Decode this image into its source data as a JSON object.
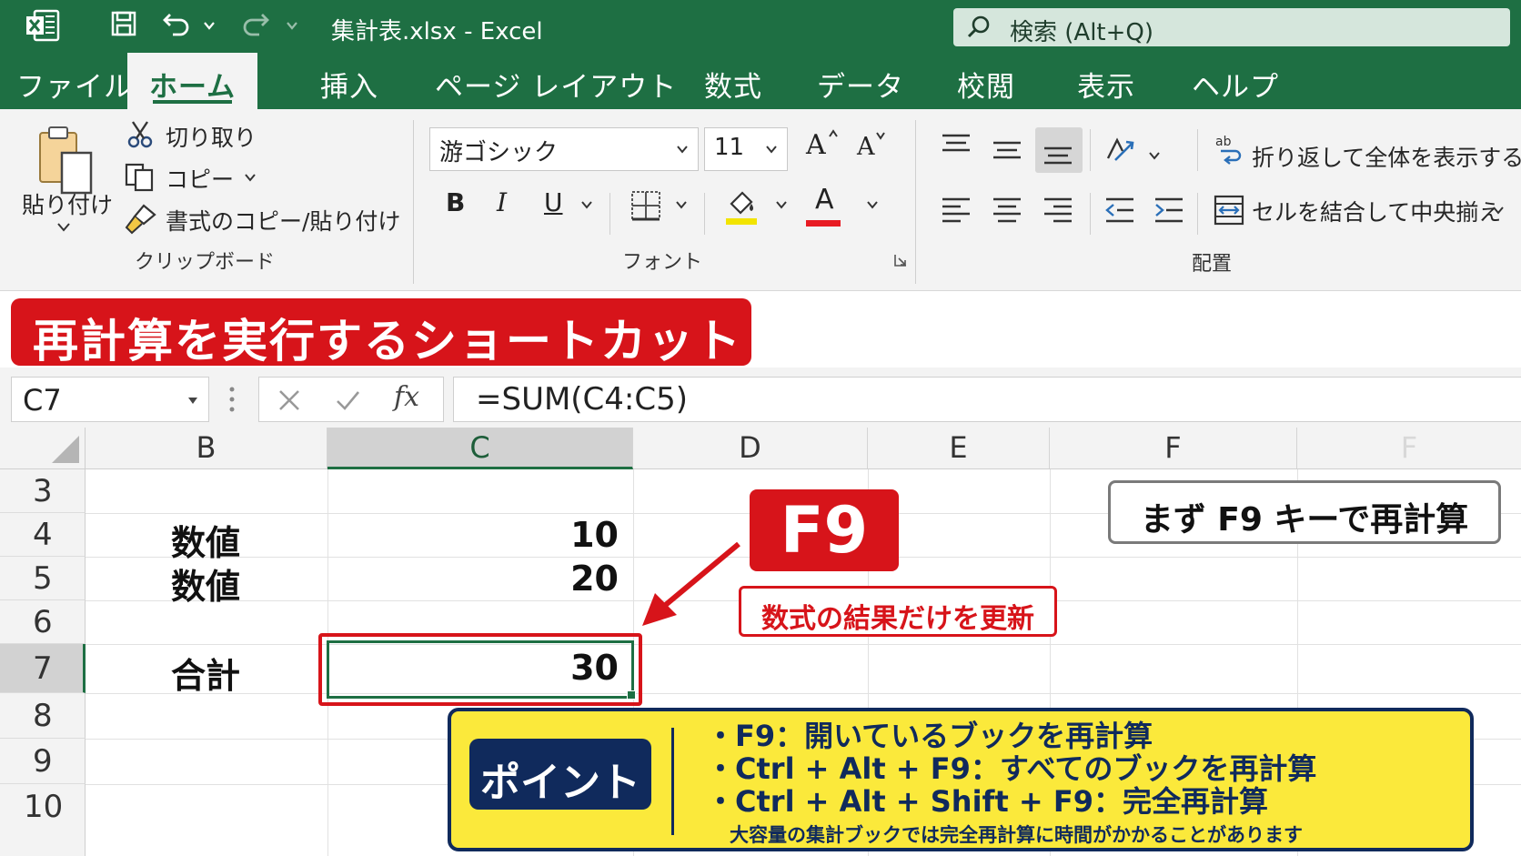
{
  "titlebar": {
    "doc_title": "集計表.xlsx  -  Excel",
    "search_label": "検索 (Alt+Q)"
  },
  "tabs": [
    "ファイル",
    "ホーム",
    "挿入",
    "ページ レイアウト",
    "数式",
    "データ",
    "校閲",
    "表示",
    "ヘルプ"
  ],
  "active_tab": "ホーム",
  "clipboard": {
    "paste_label": "貼り付け",
    "cut_label": "切り取り",
    "copy_label": "コピー",
    "format_painter_label": "書式のコピー/貼り付け",
    "group_label": "クリップボード"
  },
  "font": {
    "font_name": "游ゴシック",
    "font_size": "11",
    "grow_label": "A",
    "shrink_label": "A",
    "bold_label": "B",
    "italic_label": "I",
    "underline_label": "U",
    "font_color_label": "A",
    "group_label": "フォント"
  },
  "alignment": {
    "wrap_label": "折り返して全体を表示する",
    "merge_label": "セルを結合して中央揃え",
    "group_label": "配置"
  },
  "banner": {
    "text": "再計算を実行するショートカット"
  },
  "formula_bar": {
    "name_box": "C7",
    "fx_label": "fx",
    "formula": "=SUM(C4:C5)"
  },
  "grid": {
    "columns": [
      "B",
      "C",
      "D",
      "E",
      "F",
      "F"
    ],
    "selected_column": "C",
    "rows": [
      "3",
      "4",
      "5",
      "6",
      "7",
      "8",
      "9",
      "10"
    ],
    "selected_row": "7",
    "cells": {
      "B4": "数値",
      "C4": "10",
      "B5": "数値",
      "C5": "20",
      "B7": "合計",
      "C7": "30"
    }
  },
  "callouts": {
    "key": "F9",
    "key_note": "数式の結果だけを更新",
    "first_hint": "まず F9 キーで再計算"
  },
  "point": {
    "label": "ポイント",
    "lines": [
      "・F9：開いているブックを再計算",
      "・Ctrl + Alt + F9：すべてのブックを再計算",
      "・Ctrl + Alt + Shift + F9：完全再計算"
    ],
    "note": "大容量の集計ブックでは完全再計算に時間がかかることがあります"
  },
  "colors": {
    "excel_green": "#1e6f43",
    "accent_red": "#d7141a",
    "point_yellow": "#fbe93b",
    "point_navy": "#102a5c",
    "fill_yellow": "#f2e400",
    "font_red": "#e81b23"
  },
  "icons": {
    "app": "excel-logo-icon",
    "save": "save-icon",
    "undo": "undo-icon",
    "redo": "redo-icon",
    "search": "search-icon",
    "paste": "clipboard-paste-icon",
    "cut": "scissors-icon",
    "copy": "copy-icon",
    "format_painter": "paintbrush-icon",
    "borders": "borders-icon",
    "fill_color": "paint-bucket-icon",
    "wrap": "wrap-text-icon",
    "merge": "merge-center-icon",
    "orientation": "text-orientation-icon"
  }
}
